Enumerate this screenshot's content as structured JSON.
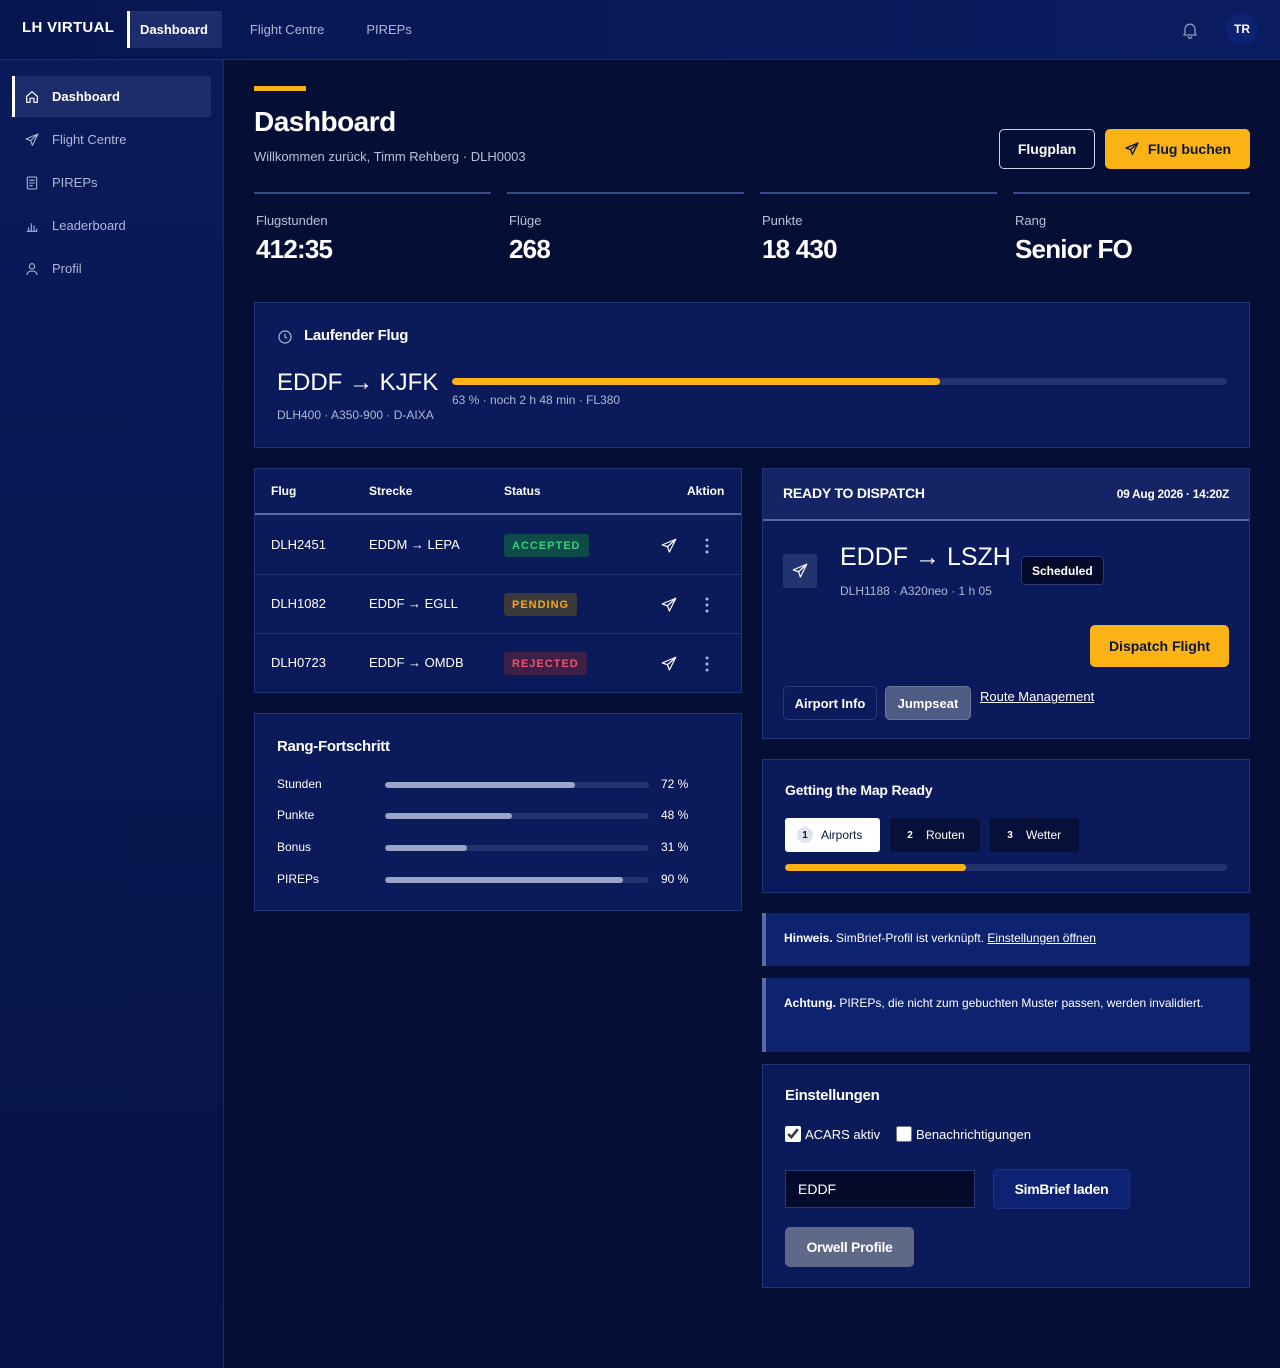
{
  "brand": "LH VIRTUAL",
  "topnav": [
    {
      "label": "Dashboard",
      "active": true
    },
    {
      "label": "Flight Centre",
      "active": false
    },
    {
      "label": "PIREPs",
      "active": false
    }
  ],
  "user": {
    "initials": "TR"
  },
  "sidebar": {
    "items": [
      {
        "label": "Dashboard",
        "icon": "home-icon"
      },
      {
        "label": "Flight Centre",
        "icon": "plane-icon"
      },
      {
        "label": "PIREPs",
        "icon": "document-icon"
      },
      {
        "label": "Leaderboard",
        "icon": "bar-chart-icon"
      },
      {
        "label": "Profil",
        "icon": "user-icon"
      }
    ]
  },
  "page": {
    "title": "Dashboard",
    "welcome": "Willkommen zurück, Timm Rehberg · DLH0003",
    "btn_flugplan": "Flugplan",
    "btn_flug_buchen": "Flug buchen"
  },
  "stats": [
    {
      "label": "Flugstunden",
      "value": "412:35"
    },
    {
      "label": "Flüge",
      "value": "268"
    },
    {
      "label": "Punkte",
      "value": "18 430"
    },
    {
      "label": "Rang",
      "value": "Senior FO"
    }
  ],
  "running_flight": {
    "title": "Laufender Flug",
    "route": "EDDF → KJFK",
    "sub": "DLH400 · A350-900 · D-AIXA",
    "progress": 0.63,
    "meta": "63 % · noch 2 h 48 min · FL380"
  },
  "flights_table": {
    "headers": {
      "flug": "Flug",
      "strecke": "Strecke",
      "status": "Status",
      "aktion": "Aktion"
    },
    "rows": [
      {
        "flug": "DLH2451",
        "strecke": "EDDM → LEPA",
        "status": "ACCEPTED"
      },
      {
        "flug": "DLH1082",
        "strecke": "EDDF → EGLL",
        "status": "PENDING"
      },
      {
        "flug": "DLH0723",
        "strecke": "EDDF → OMDB",
        "status": "REJECTED"
      }
    ]
  },
  "status_colors": {
    "accepted": "#34d17a",
    "pending": "#f5a623",
    "rejected": "#f0506e"
  },
  "rank_progress": {
    "title": "Rang-Fortschritt",
    "rows": [
      {
        "label": "Stunden",
        "pct": "72 %",
        "value": 0.72
      },
      {
        "label": "Punkte",
        "pct": "48 %",
        "value": 0.48
      },
      {
        "label": "Bonus",
        "pct": "31 %",
        "value": 0.31
      },
      {
        "label": "PIREPs",
        "pct": "90 %",
        "value": 0.9
      }
    ]
  },
  "dispatch": {
    "title": "READY TO DISPATCH",
    "date": "09 Aug 2026 · 14:20Z",
    "route": "EDDF → LSZH",
    "sub": "DLH1188 · A320neo · 1 h 05",
    "badge": "Scheduled",
    "btn_dispatch": "Dispatch Flight",
    "btn_airport": "Airport Info",
    "btn_jumpseat": "Jumpseat",
    "link_route": "Route Management"
  },
  "map_ready": {
    "title": "Getting the Map Ready",
    "steps": [
      {
        "num": "1",
        "label": "Airports"
      },
      {
        "num": "2",
        "label": "Routen"
      },
      {
        "num": "3",
        "label": "Wetter"
      }
    ],
    "progress": 0.41
  },
  "notices": {
    "hint_bold": "Hinweis.",
    "hint_text": " SimBrief-Profil ist verknüpft. ",
    "hint_link": "Einstellungen öffnen",
    "warn_bold": "Achtung.",
    "warn_text": " PIREPs, die nicht zum gebuchten Muster passen, werden invalidiert."
  },
  "settings": {
    "title": "Einstellungen",
    "acars_label": "ACARS aktiv",
    "notify_label": "Benachrichtigungen",
    "input_value": "EDDF",
    "btn_simbrief": "SimBrief laden",
    "btn_orwell": "Orwell Profile"
  },
  "colors": {
    "accent": "#fbb214",
    "bg": "#050e34",
    "card": "#0a1a5a"
  }
}
